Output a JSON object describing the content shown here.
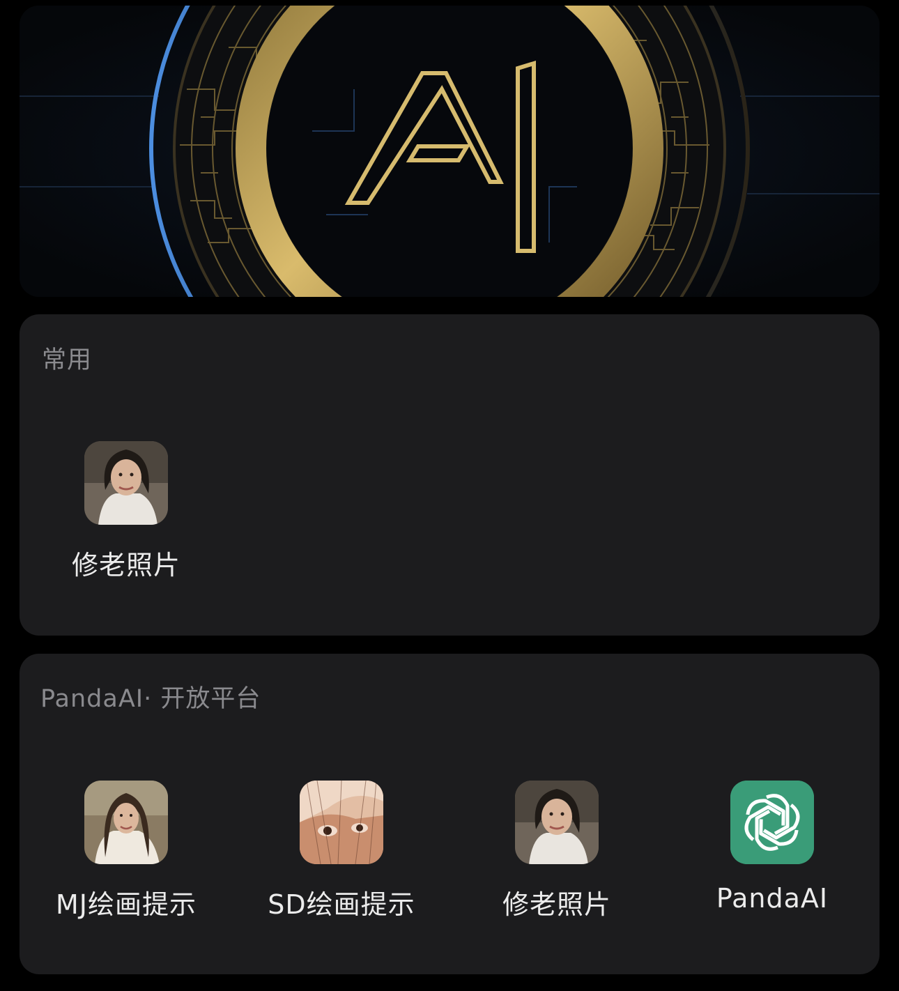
{
  "banner": {
    "logo_text": "AI",
    "colors": {
      "gold": "#c9a85a",
      "blue": "#3a7bd5",
      "dark": "#07090d"
    }
  },
  "sections": {
    "common": {
      "title": "常用",
      "apps": [
        {
          "label": "修老照片",
          "icon": "portrait-photo-icon"
        }
      ]
    },
    "platform": {
      "title": "PandaAI· 开放平台",
      "apps": [
        {
          "label": "MJ绘画提示",
          "icon": "portrait-photo-icon"
        },
        {
          "label": "SD绘画提示",
          "icon": "closeup-portrait-icon"
        },
        {
          "label": "修老照片",
          "icon": "portrait-photo-icon"
        },
        {
          "label": "PandaAI",
          "icon": "openai-knot-icon"
        }
      ]
    }
  },
  "colors": {
    "background": "#000000",
    "card": "#1c1c1e",
    "section_title": "#8a8a8e",
    "label": "#ececec",
    "pandaai_green": "#3a9c78"
  }
}
